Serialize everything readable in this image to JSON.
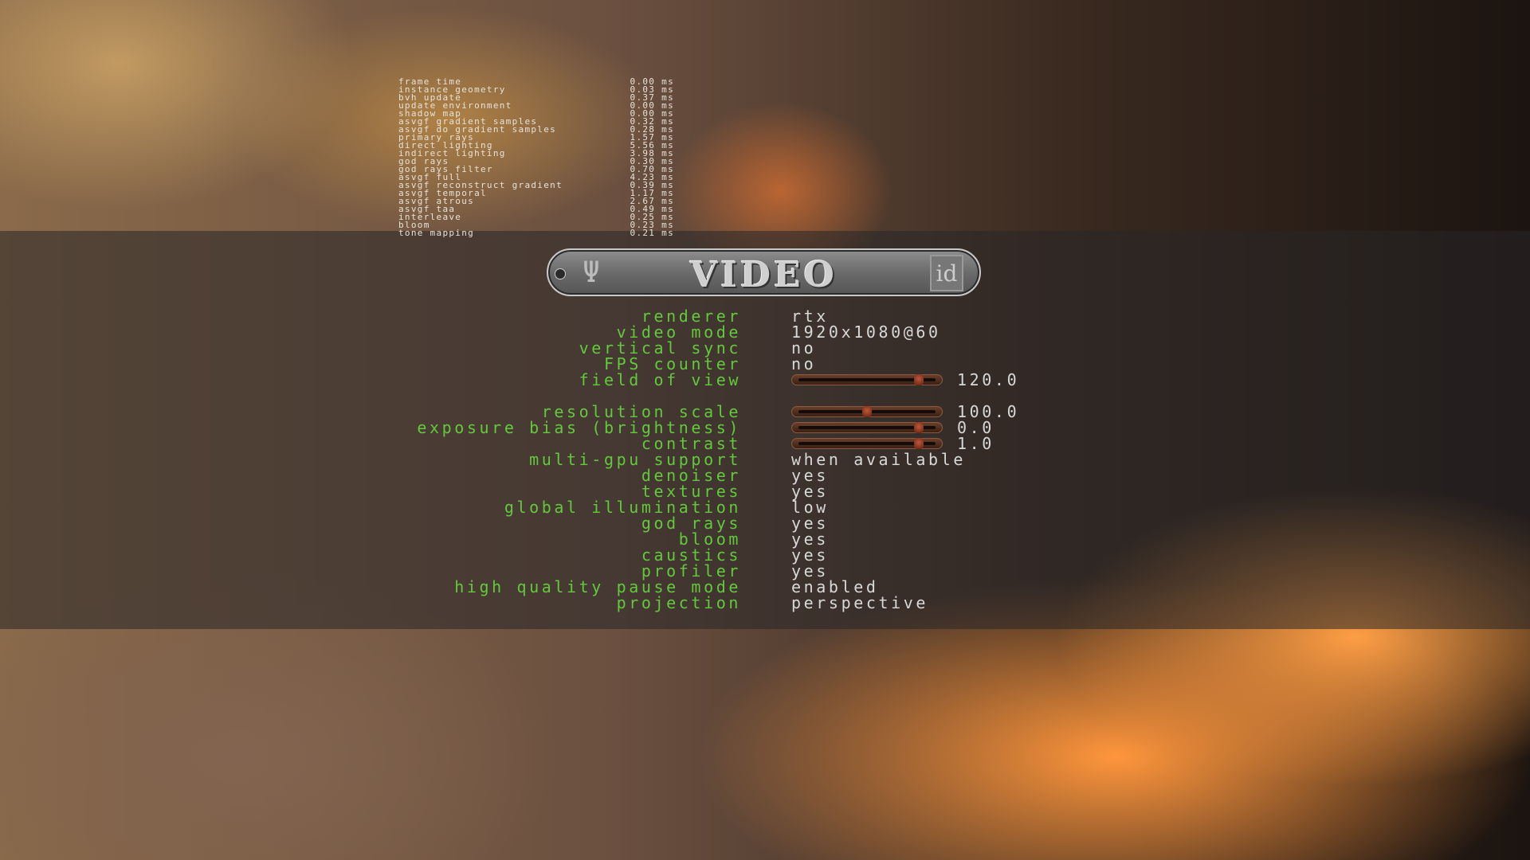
{
  "profiler": [
    {
      "name": "frame time",
      "value": "0.00 ms"
    },
    {
      "name": "instance geometry",
      "value": "0.03 ms"
    },
    {
      "name": "bvh update",
      "value": "0.37 ms"
    },
    {
      "name": "update environment",
      "value": "0.00 ms"
    },
    {
      "name": "shadow map",
      "value": "0.00 ms"
    },
    {
      "name": "asvgf gradient samples",
      "value": "0.32 ms"
    },
    {
      "name": "asvgf do gradient samples",
      "value": "0.28 ms"
    },
    {
      "name": "primary rays",
      "value": "1.57 ms"
    },
    {
      "name": "direct lighting",
      "value": "5.56 ms"
    },
    {
      "name": "indirect lighting",
      "value": "3.98 ms"
    },
    {
      "name": "god rays",
      "value": "0.30 ms"
    },
    {
      "name": "god rays filter",
      "value": "0.70 ms"
    },
    {
      "name": "asvgf full",
      "value": "4.23 ms"
    },
    {
      "name": "asvgf reconstruct gradient",
      "value": "0.39 ms"
    },
    {
      "name": "asvgf temporal",
      "value": "1.17 ms"
    },
    {
      "name": "asvgf atrous",
      "value": "2.67 ms"
    },
    {
      "name": "asvgf taa",
      "value": "0.49 ms"
    },
    {
      "name": "interleave",
      "value": "0.25 ms"
    },
    {
      "name": "bloom",
      "value": "0.23 ms"
    },
    {
      "name": "tone mapping",
      "value": "0.21 ms"
    }
  ],
  "banner": {
    "title": "VIDEO",
    "left_logo": "quake2-logo",
    "right_logo": "id-logo",
    "id_text": "id"
  },
  "menu": {
    "renderer": {
      "label": "renderer",
      "value": "rtx"
    },
    "video_mode": {
      "label": "video mode",
      "value": "1920x1080@60"
    },
    "vsync": {
      "label": "vertical sync",
      "value": "no"
    },
    "fps": {
      "label": "FPS counter",
      "value": "no"
    },
    "fov": {
      "label": "field of view",
      "value": "120.0",
      "level": 0.88
    },
    "res_scale": {
      "label": "resolution scale",
      "value": "100.0",
      "level": 0.5
    },
    "exposure": {
      "label": "exposure bias (brightness)",
      "value": "0.0",
      "level": 0.88
    },
    "contrast": {
      "label": "contrast",
      "value": "1.0",
      "level": 0.88
    },
    "multigpu": {
      "label": "multi-gpu support",
      "value": "when available"
    },
    "denoiser": {
      "label": "denoiser",
      "value": "yes"
    },
    "textures": {
      "label": "textures",
      "value": "yes"
    },
    "gi": {
      "label": "global illumination",
      "value": "low"
    },
    "godrays": {
      "label": "god rays",
      "value": "yes"
    },
    "bloom": {
      "label": "bloom",
      "value": "yes"
    },
    "caustics": {
      "label": "caustics",
      "value": "yes"
    },
    "profiler": {
      "label": "profiler",
      "value": "yes"
    },
    "pause": {
      "label": "high quality pause mode",
      "value": "enabled"
    },
    "projection": {
      "label": "projection",
      "value": "perspective"
    }
  },
  "colors": {
    "label": "#62c93c",
    "value": "#d8d8d8"
  }
}
